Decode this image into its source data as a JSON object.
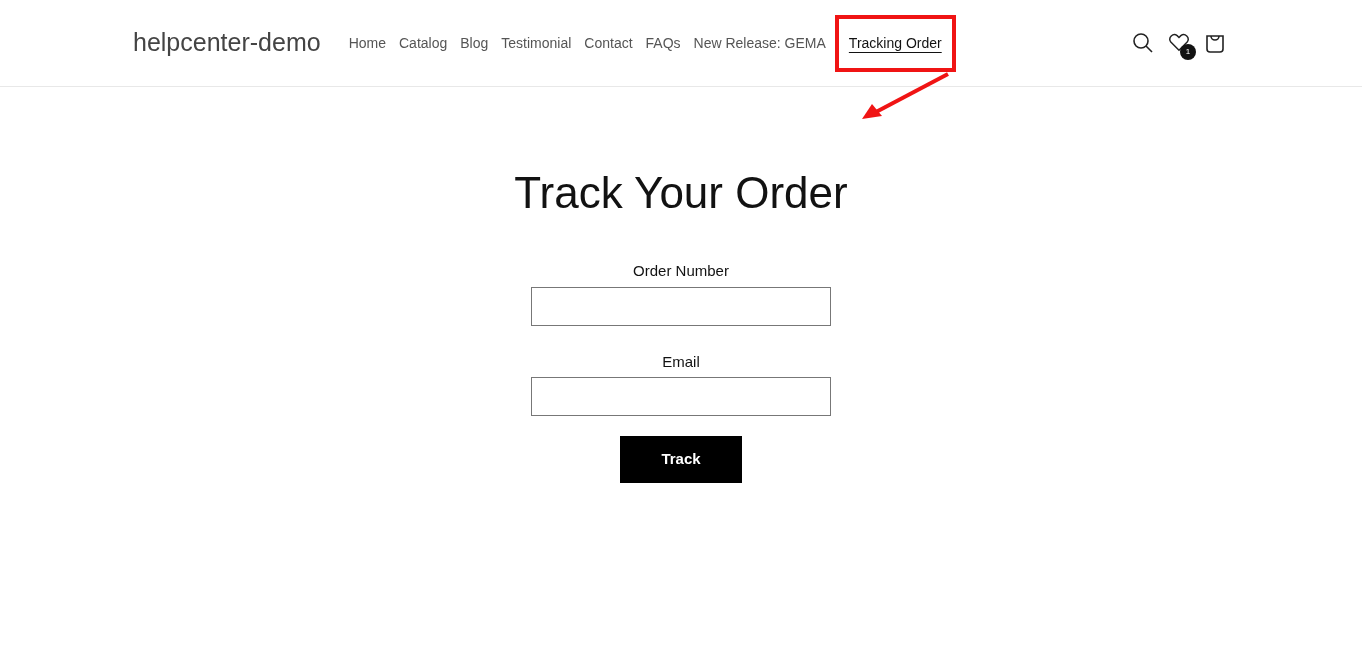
{
  "header": {
    "logo": "helpcenter-demo",
    "nav": [
      {
        "label": "Home",
        "selected": false
      },
      {
        "label": "Catalog",
        "selected": false
      },
      {
        "label": "Blog",
        "selected": false
      },
      {
        "label": "Testimonial",
        "selected": false
      },
      {
        "label": "Contact",
        "selected": false
      },
      {
        "label": "FAQs",
        "selected": false
      },
      {
        "label": "New Release: GEMA",
        "selected": false
      },
      {
        "label": "Tracking Order",
        "selected": true
      }
    ],
    "wishlist_count": "1"
  },
  "title": "Track Your Order",
  "form": {
    "fields": [
      {
        "label": "Order Number"
      },
      {
        "label": "Email"
      }
    ],
    "button": "Track"
  }
}
